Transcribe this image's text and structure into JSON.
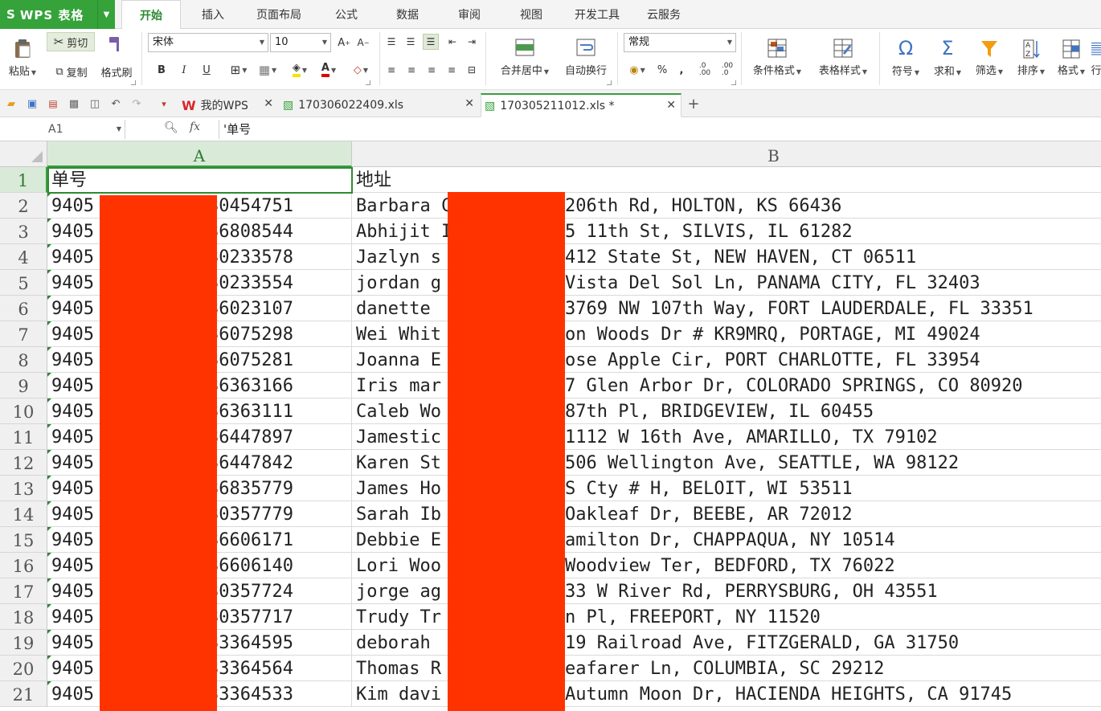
{
  "app": {
    "logo": "S",
    "name": "WPS 表格"
  },
  "menu": [
    "开始",
    "插入",
    "页面布局",
    "公式",
    "数据",
    "审阅",
    "视图",
    "开发工具",
    "云服务"
  ],
  "ribbon": {
    "paste": "粘贴",
    "cut": "剪切",
    "copy": "复制",
    "format_painter": "格式刷",
    "font_name": "宋体",
    "font_size": "10",
    "bold": "B",
    "italic": "I",
    "underline": "U",
    "merge_center": "合并居中",
    "wrap_text": "自动换行",
    "number_format": "常规",
    "percent": "%",
    "conditional_format": "条件格式",
    "table_style": "表格样式",
    "symbol": "符号",
    "sum": "求和",
    "filter": "筛选",
    "sort": "排序",
    "format": "格式",
    "more": "行"
  },
  "doc_tabs": [
    {
      "label": "我的WPS",
      "active": false
    },
    {
      "label": "170306022409.xls",
      "active": false
    },
    {
      "label": "170305211012.xls *",
      "active": true
    }
  ],
  "formula_bar": {
    "name_box": "A1",
    "fx": "fx",
    "content": "'单号"
  },
  "sheet": {
    "columns": [
      "A",
      "B"
    ],
    "rows": [
      {
        "num": "1",
        "a": "单号",
        "b": "地址"
      },
      {
        "num": "2",
        "a": "9405",
        "a2": "30454751",
        "b": "Barbara C",
        "b2": "206th Rd, HOLTON, KS 66436"
      },
      {
        "num": "3",
        "a": "9405",
        "a2": "36808544",
        "b": "Abhijit I",
        "b2": "5 11th St, SILVIS, IL 61282"
      },
      {
        "num": "4",
        "a": "9405",
        "a2": "30233578",
        "b": "Jazlyn s",
        "b2": "412 State St, NEW HAVEN, CT 06511"
      },
      {
        "num": "5",
        "a": "9405",
        "a2": "30233554",
        "b": "jordan g",
        "b2": "Vista Del Sol Ln, PANAMA CITY, FL 32403"
      },
      {
        "num": "6",
        "a": "9405",
        "a2": "36023107",
        "b": "danette",
        "b2": "3769 NW 107th Way, FORT LAUDERDALE, FL 33351"
      },
      {
        "num": "7",
        "a": "9405",
        "a2": "36075298",
        "b": "Wei Whit",
        "b2": "on Woods Dr # KR9MRQ, PORTAGE, MI 49024"
      },
      {
        "num": "8",
        "a": "9405",
        "a2": "36075281",
        "b": "Joanna E",
        "b2": "ose Apple Cir, PORT CHARLOTTE, FL 33954"
      },
      {
        "num": "9",
        "a": "9405",
        "a2": "36363166",
        "b": "Iris mar",
        "b2": "7 Glen Arbor Dr, COLORADO SPRINGS, CO 80920"
      },
      {
        "num": "10",
        "a": "9405",
        "a2": "36363111",
        "b": "Caleb Wo",
        "b2": "87th Pl, BRIDGEVIEW, IL 60455"
      },
      {
        "num": "11",
        "a": "9405",
        "a2": "36447897",
        "b": "Jamestic",
        "b2": "1112 W 16th Ave, AMARILLO, TX 79102"
      },
      {
        "num": "12",
        "a": "9405",
        "a2": "36447842",
        "b": "Karen St",
        "b2": "506 Wellington Ave, SEATTLE, WA 98122"
      },
      {
        "num": "13",
        "a": "9405",
        "a2": "36835779",
        "b": "James Ho",
        "b2": "S Cty # H, BELOIT, WI 53511"
      },
      {
        "num": "14",
        "a": "9405",
        "a2": "30357779",
        "b": "Sarah Ib",
        "b2": "Oakleaf Dr, BEEBE, AR 72012"
      },
      {
        "num": "15",
        "a": "9405",
        "a2": "36606171",
        "b": "Debbie E",
        "b2": "amilton Dr, CHAPPAQUA, NY 10514"
      },
      {
        "num": "16",
        "a": "9405",
        "a2": "36606140",
        "b": "Lori Woo",
        "b2": "Woodview Ter, BEDFORD, TX 76022"
      },
      {
        "num": "17",
        "a": "9405",
        "a2": "30357724",
        "b": "jorge ag",
        "b2": "33 W River Rd, PERRYSBURG, OH 43551"
      },
      {
        "num": "18",
        "a": "9405",
        "a2": "30357717",
        "b": "Trudy Tr",
        "b2": "n Pl, FREEPORT, NY 11520"
      },
      {
        "num": "19",
        "a": "9405",
        "a2": "33364595",
        "b": "deborah",
        "b2": "19 Railroad Ave, FITZGERALD, GA 31750"
      },
      {
        "num": "20",
        "a": "9405",
        "a2": "33364564",
        "b": "Thomas R",
        "b2": "eafarer Ln, COLUMBIA, SC 29212"
      },
      {
        "num": "21",
        "a": "9405",
        "a2": "33364533",
        "b": "Kim davi",
        "b2": "Autumn Moon Dr, HACIENDA HEIGHTS, CA 91745"
      }
    ]
  },
  "colors": {
    "accent": "#35a33a",
    "redaction": "#ff3300",
    "selection": "#2e8b33"
  }
}
